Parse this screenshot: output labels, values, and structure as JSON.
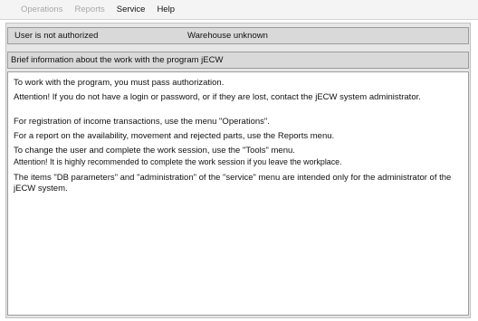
{
  "menubar": {
    "items": [
      {
        "label": "Operations",
        "enabled": false
      },
      {
        "label": "Reports",
        "enabled": false
      },
      {
        "label": "Service",
        "enabled": true
      },
      {
        "label": "Help",
        "enabled": true
      }
    ]
  },
  "status": {
    "user": "User is not authorized",
    "warehouse": "Warehouse unknown"
  },
  "panel": {
    "title": "Brief information about the work with the program jECW"
  },
  "content": {
    "paragraphs": [
      "To work with the program, you must pass authorization.",
      "Attention! If you do not have a login or password, or if they are lost, contact the jECW system administrator.",
      "For registration of income transactions, use the menu \"Operations\".",
      "For a report on the availability, movement and rejected parts, use the Reports menu.",
      "To change the user and complete the work session, use the \"Tools\" menu.",
      "Attention! It is highly recommended to complete the work session if you leave the workplace.",
      "The items \"DB parameters\" and \"administration\" of the \"service\" menu are intended only for the administrator of the jECW system."
    ]
  },
  "colors": {
    "menu_disabled": "#a8a8a8",
    "panel_bar": "#d9d9d9",
    "content_bg": "#ffffff"
  }
}
